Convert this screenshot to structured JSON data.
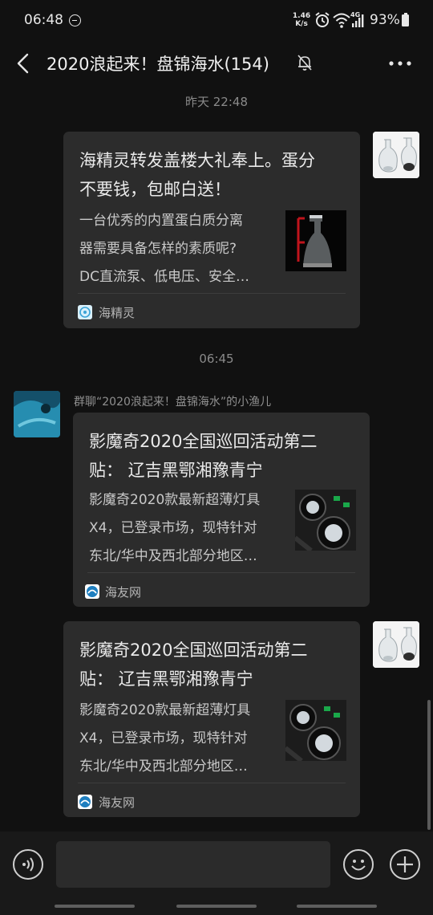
{
  "status_bar": {
    "time": "06:48",
    "net_speed_value": "1.46",
    "net_speed_unit": "K/s",
    "network_type": "4G",
    "battery": "93%"
  },
  "header": {
    "title": "2020浪起来！盘锦海水(154)"
  },
  "messages": [
    {
      "timestamp": "昨天 22:48",
      "side": "right",
      "title_lines": [
        "海精灵转发盖楼大礼奉上。蛋分",
        "不要钱，包邮白送！"
      ],
      "desc_lines": [
        "一台优秀的内置蛋白质分离",
        "器需要具备怎样的素质呢?",
        "DC直流泵、低电压、安全…"
      ],
      "source": "海精灵"
    },
    {
      "timestamp": "06:45",
      "side": "left",
      "sender": "群聊“2020浪起来！盘锦海水”的小渔儿",
      "title_lines": [
        "影魔奇2020全国巡回活动第二",
        "贴：  辽吉黑鄂湘豫青宁"
      ],
      "desc_lines": [
        "影魔奇2020款最新超薄灯具",
        "X4，已登录市场，现特针对",
        "东北/华中及西北部分地区…"
      ],
      "source": "海友网"
    },
    {
      "side": "right",
      "title_lines": [
        "影魔奇2020全国巡回活动第二",
        "贴：  辽吉黑鄂湘豫青宁"
      ],
      "desc_lines": [
        "影魔奇2020款最新超薄灯具",
        "X4，已登录市场，现特针对",
        "东北/华中及西北部分地区…"
      ],
      "source": "海友网"
    }
  ],
  "input": {
    "placeholder": ""
  }
}
